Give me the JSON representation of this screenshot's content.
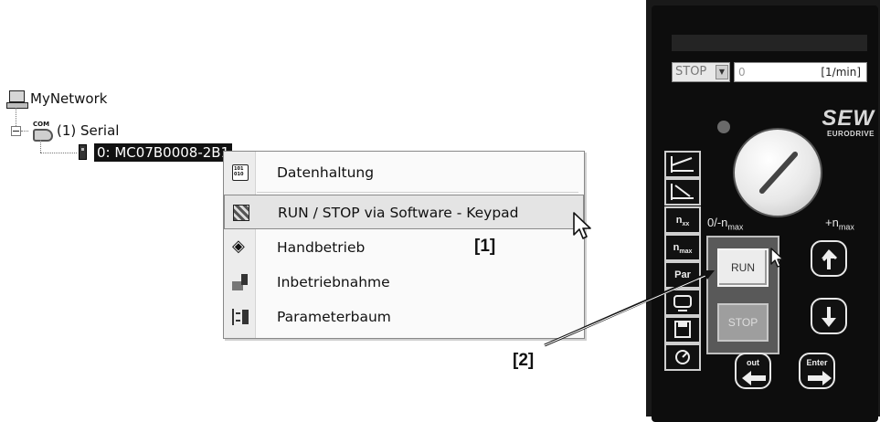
{
  "tree": {
    "root_label": "MyNetwork",
    "serial_label": "(1) Serial",
    "com_tag": "COM",
    "device_label": "0: MC07B0008-2B1"
  },
  "menu": {
    "items": [
      {
        "label": "Datenhaltung",
        "icon": "data-storage-icon"
      },
      {
        "label": "RUN / STOP via Software - Keypad",
        "icon": "keypad-icon"
      },
      {
        "label": "Handbetrieb",
        "icon": "manual-mode-icon"
      },
      {
        "label": "Inbetriebnahme",
        "icon": "startup-icon"
      },
      {
        "label": "Parameterbaum",
        "icon": "parameter-tree-icon"
      }
    ]
  },
  "annotations": {
    "one": "[1]",
    "two": "[2]"
  },
  "keypad": {
    "mode_value": "STOP",
    "speed_value": "0",
    "speed_unit": "[1/min]",
    "brand": "SEW",
    "brand_sub": "EURODRIVE",
    "knob_min_label": "0/-n",
    "knob_min_sub": "max",
    "knob_max_label": "+n",
    "knob_max_sub": "max",
    "side_keys": [
      {
        "label": "",
        "icon": "ramp-up-icon"
      },
      {
        "label": "",
        "icon": "ramp-down-icon"
      },
      {
        "label": "n",
        "sub": "xx"
      },
      {
        "label": "n",
        "sub": "max"
      },
      {
        "label": "Par"
      },
      {
        "label": "",
        "icon": "display-icon"
      },
      {
        "label": "",
        "icon": "save-icon"
      },
      {
        "label": "",
        "icon": "gauge-icon"
      }
    ],
    "run_label": "RUN",
    "stop_label": "STOP",
    "out_label": "out",
    "enter_label": "Enter"
  },
  "colors": {
    "panel": "#0d0d0d",
    "selection": "#111111",
    "menu_hover": "#e4e4e4"
  }
}
